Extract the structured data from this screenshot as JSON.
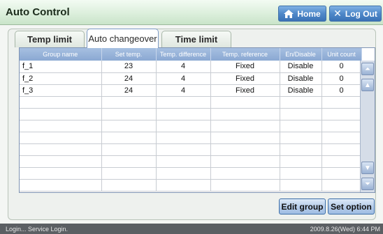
{
  "window": {
    "title": "Auto Control",
    "home_label": "Home",
    "logout_label": "Log Out"
  },
  "tabs": [
    {
      "label": "Temp limit",
      "active": false
    },
    {
      "label": "Auto changeover",
      "active": true
    },
    {
      "label": "Time limit",
      "active": false
    }
  ],
  "table": {
    "headers": [
      "Group name",
      "Set temp.",
      "Temp. difference",
      "Temp. reference",
      "En/Disable",
      "Unit count"
    ],
    "rows": [
      [
        "f_1",
        "23",
        "4",
        "Fixed",
        "Disable",
        "0"
      ],
      [
        "f_2",
        "24",
        "4",
        "Fixed",
        "Disable",
        "0"
      ],
      [
        "f_3",
        "24",
        "4",
        "Fixed",
        "Disable",
        "0"
      ],
      [
        "",
        "",
        "",
        "",
        "",
        ""
      ],
      [
        "",
        "",
        "",
        "",
        "",
        ""
      ],
      [
        "",
        "",
        "",
        "",
        "",
        ""
      ],
      [
        "",
        "",
        "",
        "",
        "",
        ""
      ],
      [
        "",
        "",
        "",
        "",
        "",
        ""
      ],
      [
        "",
        "",
        "",
        "",
        "",
        ""
      ],
      [
        "",
        "",
        "",
        "",
        "",
        ""
      ],
      [
        "",
        "",
        "",
        "",
        "",
        ""
      ]
    ]
  },
  "actions": {
    "edit_group": "Edit group",
    "set_option": "Set option"
  },
  "status": {
    "left": "Login... Service Login.",
    "right": "2009.8.26(Wed)  6:44 PM"
  },
  "colors": {
    "title_bar": "#d7ead7",
    "button_blue": "#4f88c9",
    "header_blue": "#8aa8d2",
    "status_bg": "#5b5f63"
  }
}
